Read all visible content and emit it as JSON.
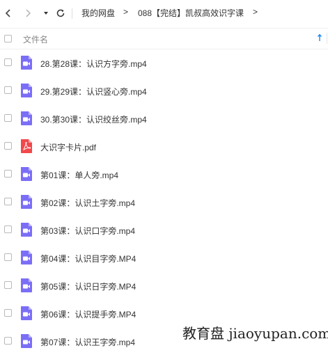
{
  "nav": {
    "breadcrumb_root": "我的网盘",
    "breadcrumb_sep_1": ">",
    "breadcrumb_folder": "088【完结】凯叔高效识字课",
    "breadcrumb_sep_2": ">"
  },
  "header": {
    "column_title": "文件名"
  },
  "files": [
    {
      "name": "28.第28课：认识方字旁.mp4",
      "type": "video"
    },
    {
      "name": "29.第29课：认识竖心旁.mp4",
      "type": "video"
    },
    {
      "name": "30.第30课：认识绞丝旁.mp4",
      "type": "video"
    },
    {
      "name": "大识字卡片.pdf",
      "type": "pdf"
    },
    {
      "name": "第01课：单人旁.mp4",
      "type": "video"
    },
    {
      "name": "第02课：认识土字旁.mp4",
      "type": "video"
    },
    {
      "name": "第03课：认识口字旁.mp4",
      "type": "video"
    },
    {
      "name": "第04课：认识目字旁.MP4",
      "type": "video"
    },
    {
      "name": "第05课：认识日字旁.MP4",
      "type": "video"
    },
    {
      "name": "第06课：认识提手旁.MP4",
      "type": "video"
    },
    {
      "name": "第07课：认识王字旁.mp4",
      "type": "video"
    }
  ],
  "watermark": "教育盘 jiaoyupan.com",
  "colors": {
    "video_icon": "#7b6ef6",
    "pdf_icon": "#f2484b",
    "sort_arrow": "#2b8ff5"
  }
}
